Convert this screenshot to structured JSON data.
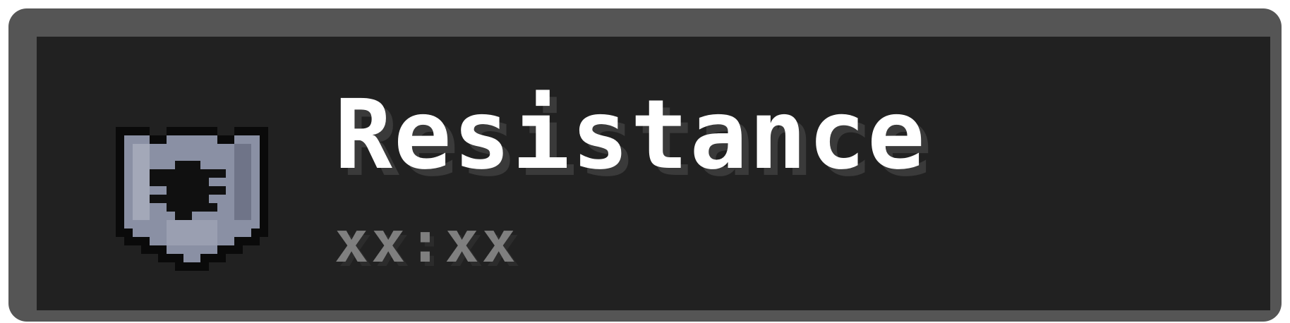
{
  "effect": {
    "icon": "resistance-shield-icon",
    "name": "Resistance",
    "duration": "xx:xx"
  },
  "colors": {
    "frame": "#555555",
    "panel": "#212121",
    "name_text": "#ffffff",
    "duration_text": "#7f7f7f",
    "shield_fill": "#8a90a4",
    "shield_outline": "#0a0a0a"
  }
}
